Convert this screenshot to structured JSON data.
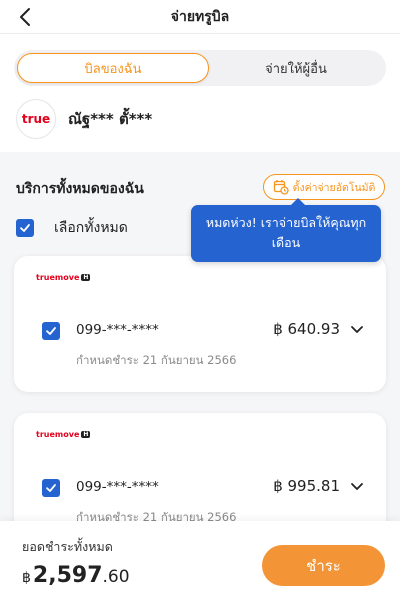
{
  "header": {
    "title": "จ่ายทรูบิล"
  },
  "tabs": [
    {
      "label": "บิลของฉัน",
      "active": true
    },
    {
      "label": "จ่ายให้ผู้อื่น",
      "active": false
    }
  ],
  "account": {
    "logo_text": "true",
    "name": "ณัฐ*** ตั้***"
  },
  "services": {
    "title": "บริการทั้งหมดของฉัน",
    "autopay_label": "ตั้งค่าจ่ายอัตโนมัติ",
    "select_all_label": "เลือกทั้งหมด",
    "select_all_checked": true
  },
  "tooltip": {
    "text": "หมดห่วง! เราจ่ายบิลให้คุณทุกเดือน"
  },
  "bills": [
    {
      "brand": "truemove",
      "brand_badge": "H",
      "phone": "099-***-****",
      "due": "กำหนดชำระ 21 กันยายน 2566",
      "amount": "฿ 640.93",
      "checked": true
    },
    {
      "brand": "truemove",
      "brand_badge": "H",
      "phone": "099-***-****",
      "due": "กำหนดชำระ 21 กันยายน 2566",
      "amount": "฿ 995.81",
      "checked": true
    }
  ],
  "footer": {
    "total_label": "ยอดชำระทั้งหมด",
    "currency": "฿",
    "total_main": "2,597",
    "total_decimal": ".60",
    "pay_label": "ชำระ"
  },
  "colors": {
    "accent": "#f7941d",
    "primary_blue": "#2463d0",
    "brand_red": "#e3001b"
  }
}
